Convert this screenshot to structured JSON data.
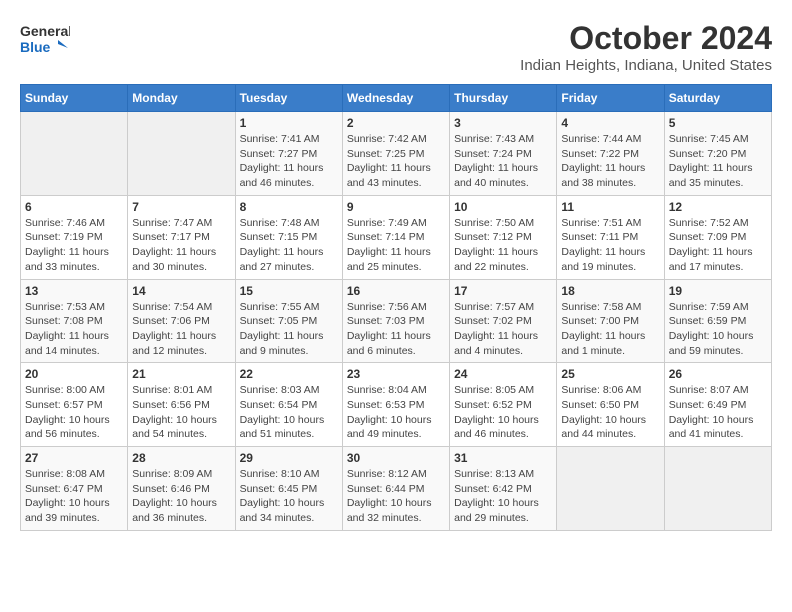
{
  "header": {
    "logo_line1": "General",
    "logo_line2": "Blue",
    "title": "October 2024",
    "subtitle": "Indian Heights, Indiana, United States"
  },
  "days_of_week": [
    "Sunday",
    "Monday",
    "Tuesday",
    "Wednesday",
    "Thursday",
    "Friday",
    "Saturday"
  ],
  "weeks": [
    [
      {
        "day": "",
        "info": ""
      },
      {
        "day": "",
        "info": ""
      },
      {
        "day": "1",
        "info": "Sunrise: 7:41 AM\nSunset: 7:27 PM\nDaylight: 11 hours and 46 minutes."
      },
      {
        "day": "2",
        "info": "Sunrise: 7:42 AM\nSunset: 7:25 PM\nDaylight: 11 hours and 43 minutes."
      },
      {
        "day": "3",
        "info": "Sunrise: 7:43 AM\nSunset: 7:24 PM\nDaylight: 11 hours and 40 minutes."
      },
      {
        "day": "4",
        "info": "Sunrise: 7:44 AM\nSunset: 7:22 PM\nDaylight: 11 hours and 38 minutes."
      },
      {
        "day": "5",
        "info": "Sunrise: 7:45 AM\nSunset: 7:20 PM\nDaylight: 11 hours and 35 minutes."
      }
    ],
    [
      {
        "day": "6",
        "info": "Sunrise: 7:46 AM\nSunset: 7:19 PM\nDaylight: 11 hours and 33 minutes."
      },
      {
        "day": "7",
        "info": "Sunrise: 7:47 AM\nSunset: 7:17 PM\nDaylight: 11 hours and 30 minutes."
      },
      {
        "day": "8",
        "info": "Sunrise: 7:48 AM\nSunset: 7:15 PM\nDaylight: 11 hours and 27 minutes."
      },
      {
        "day": "9",
        "info": "Sunrise: 7:49 AM\nSunset: 7:14 PM\nDaylight: 11 hours and 25 minutes."
      },
      {
        "day": "10",
        "info": "Sunrise: 7:50 AM\nSunset: 7:12 PM\nDaylight: 11 hours and 22 minutes."
      },
      {
        "day": "11",
        "info": "Sunrise: 7:51 AM\nSunset: 7:11 PM\nDaylight: 11 hours and 19 minutes."
      },
      {
        "day": "12",
        "info": "Sunrise: 7:52 AM\nSunset: 7:09 PM\nDaylight: 11 hours and 17 minutes."
      }
    ],
    [
      {
        "day": "13",
        "info": "Sunrise: 7:53 AM\nSunset: 7:08 PM\nDaylight: 11 hours and 14 minutes."
      },
      {
        "day": "14",
        "info": "Sunrise: 7:54 AM\nSunset: 7:06 PM\nDaylight: 11 hours and 12 minutes."
      },
      {
        "day": "15",
        "info": "Sunrise: 7:55 AM\nSunset: 7:05 PM\nDaylight: 11 hours and 9 minutes."
      },
      {
        "day": "16",
        "info": "Sunrise: 7:56 AM\nSunset: 7:03 PM\nDaylight: 11 hours and 6 minutes."
      },
      {
        "day": "17",
        "info": "Sunrise: 7:57 AM\nSunset: 7:02 PM\nDaylight: 11 hours and 4 minutes."
      },
      {
        "day": "18",
        "info": "Sunrise: 7:58 AM\nSunset: 7:00 PM\nDaylight: 11 hours and 1 minute."
      },
      {
        "day": "19",
        "info": "Sunrise: 7:59 AM\nSunset: 6:59 PM\nDaylight: 10 hours and 59 minutes."
      }
    ],
    [
      {
        "day": "20",
        "info": "Sunrise: 8:00 AM\nSunset: 6:57 PM\nDaylight: 10 hours and 56 minutes."
      },
      {
        "day": "21",
        "info": "Sunrise: 8:01 AM\nSunset: 6:56 PM\nDaylight: 10 hours and 54 minutes."
      },
      {
        "day": "22",
        "info": "Sunrise: 8:03 AM\nSunset: 6:54 PM\nDaylight: 10 hours and 51 minutes."
      },
      {
        "day": "23",
        "info": "Sunrise: 8:04 AM\nSunset: 6:53 PM\nDaylight: 10 hours and 49 minutes."
      },
      {
        "day": "24",
        "info": "Sunrise: 8:05 AM\nSunset: 6:52 PM\nDaylight: 10 hours and 46 minutes."
      },
      {
        "day": "25",
        "info": "Sunrise: 8:06 AM\nSunset: 6:50 PM\nDaylight: 10 hours and 44 minutes."
      },
      {
        "day": "26",
        "info": "Sunrise: 8:07 AM\nSunset: 6:49 PM\nDaylight: 10 hours and 41 minutes."
      }
    ],
    [
      {
        "day": "27",
        "info": "Sunrise: 8:08 AM\nSunset: 6:47 PM\nDaylight: 10 hours and 39 minutes."
      },
      {
        "day": "28",
        "info": "Sunrise: 8:09 AM\nSunset: 6:46 PM\nDaylight: 10 hours and 36 minutes."
      },
      {
        "day": "29",
        "info": "Sunrise: 8:10 AM\nSunset: 6:45 PM\nDaylight: 10 hours and 34 minutes."
      },
      {
        "day": "30",
        "info": "Sunrise: 8:12 AM\nSunset: 6:44 PM\nDaylight: 10 hours and 32 minutes."
      },
      {
        "day": "31",
        "info": "Sunrise: 8:13 AM\nSunset: 6:42 PM\nDaylight: 10 hours and 29 minutes."
      },
      {
        "day": "",
        "info": ""
      },
      {
        "day": "",
        "info": ""
      }
    ]
  ]
}
